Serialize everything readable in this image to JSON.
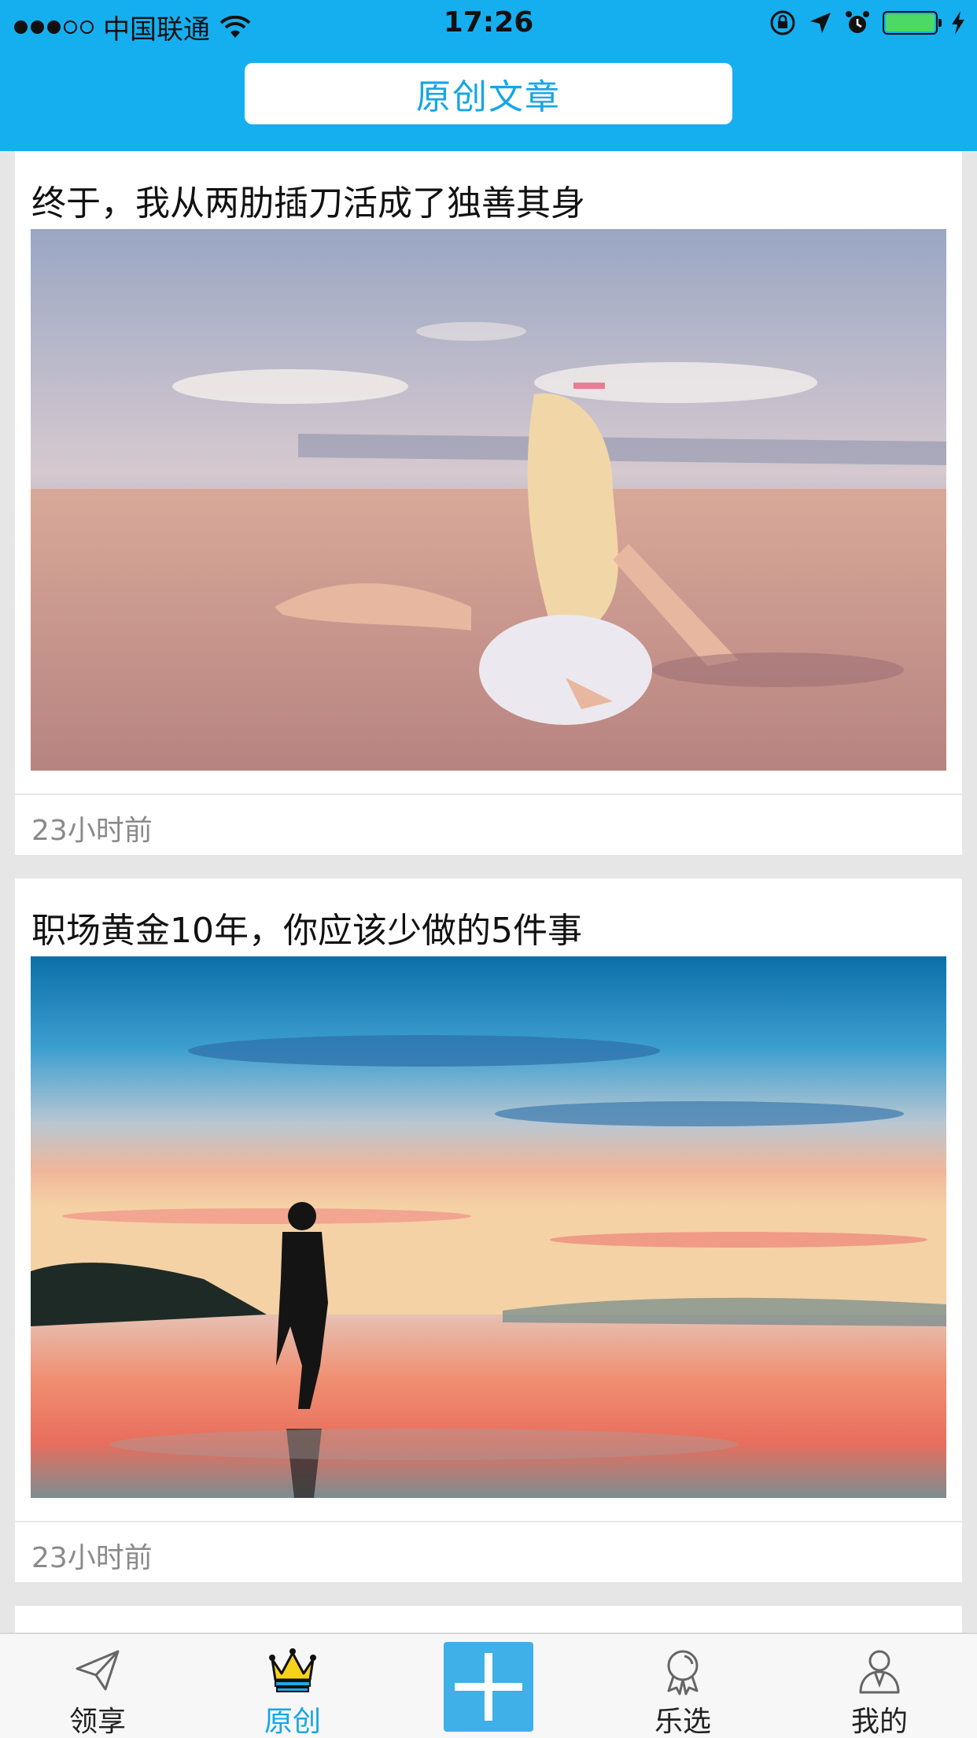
{
  "status_bar": {
    "carrier": "中国联通",
    "time": "17:26"
  },
  "header": {
    "title": "原创文章"
  },
  "articles": [
    {
      "title": "终于，我从两肋插刀活成了独善其身",
      "time": "23小时前",
      "image": "woman-on-beach-photo"
    },
    {
      "title": "职场黄金10年，你应该少做的5件事",
      "time": "23小时前",
      "image": "sunset-silhouette-photo"
    }
  ],
  "tabs": [
    {
      "label": "领享",
      "icon": "paper-plane-icon"
    },
    {
      "label": "原创",
      "icon": "crown-icon"
    },
    {
      "label": "",
      "icon": "plus-icon"
    },
    {
      "label": "乐选",
      "icon": "award-icon"
    },
    {
      "label": "我的",
      "icon": "user-icon"
    }
  ],
  "colors": {
    "accent": "#15aff0",
    "active_tab": "#15a6e6",
    "add_button": "#3fb0e8"
  }
}
